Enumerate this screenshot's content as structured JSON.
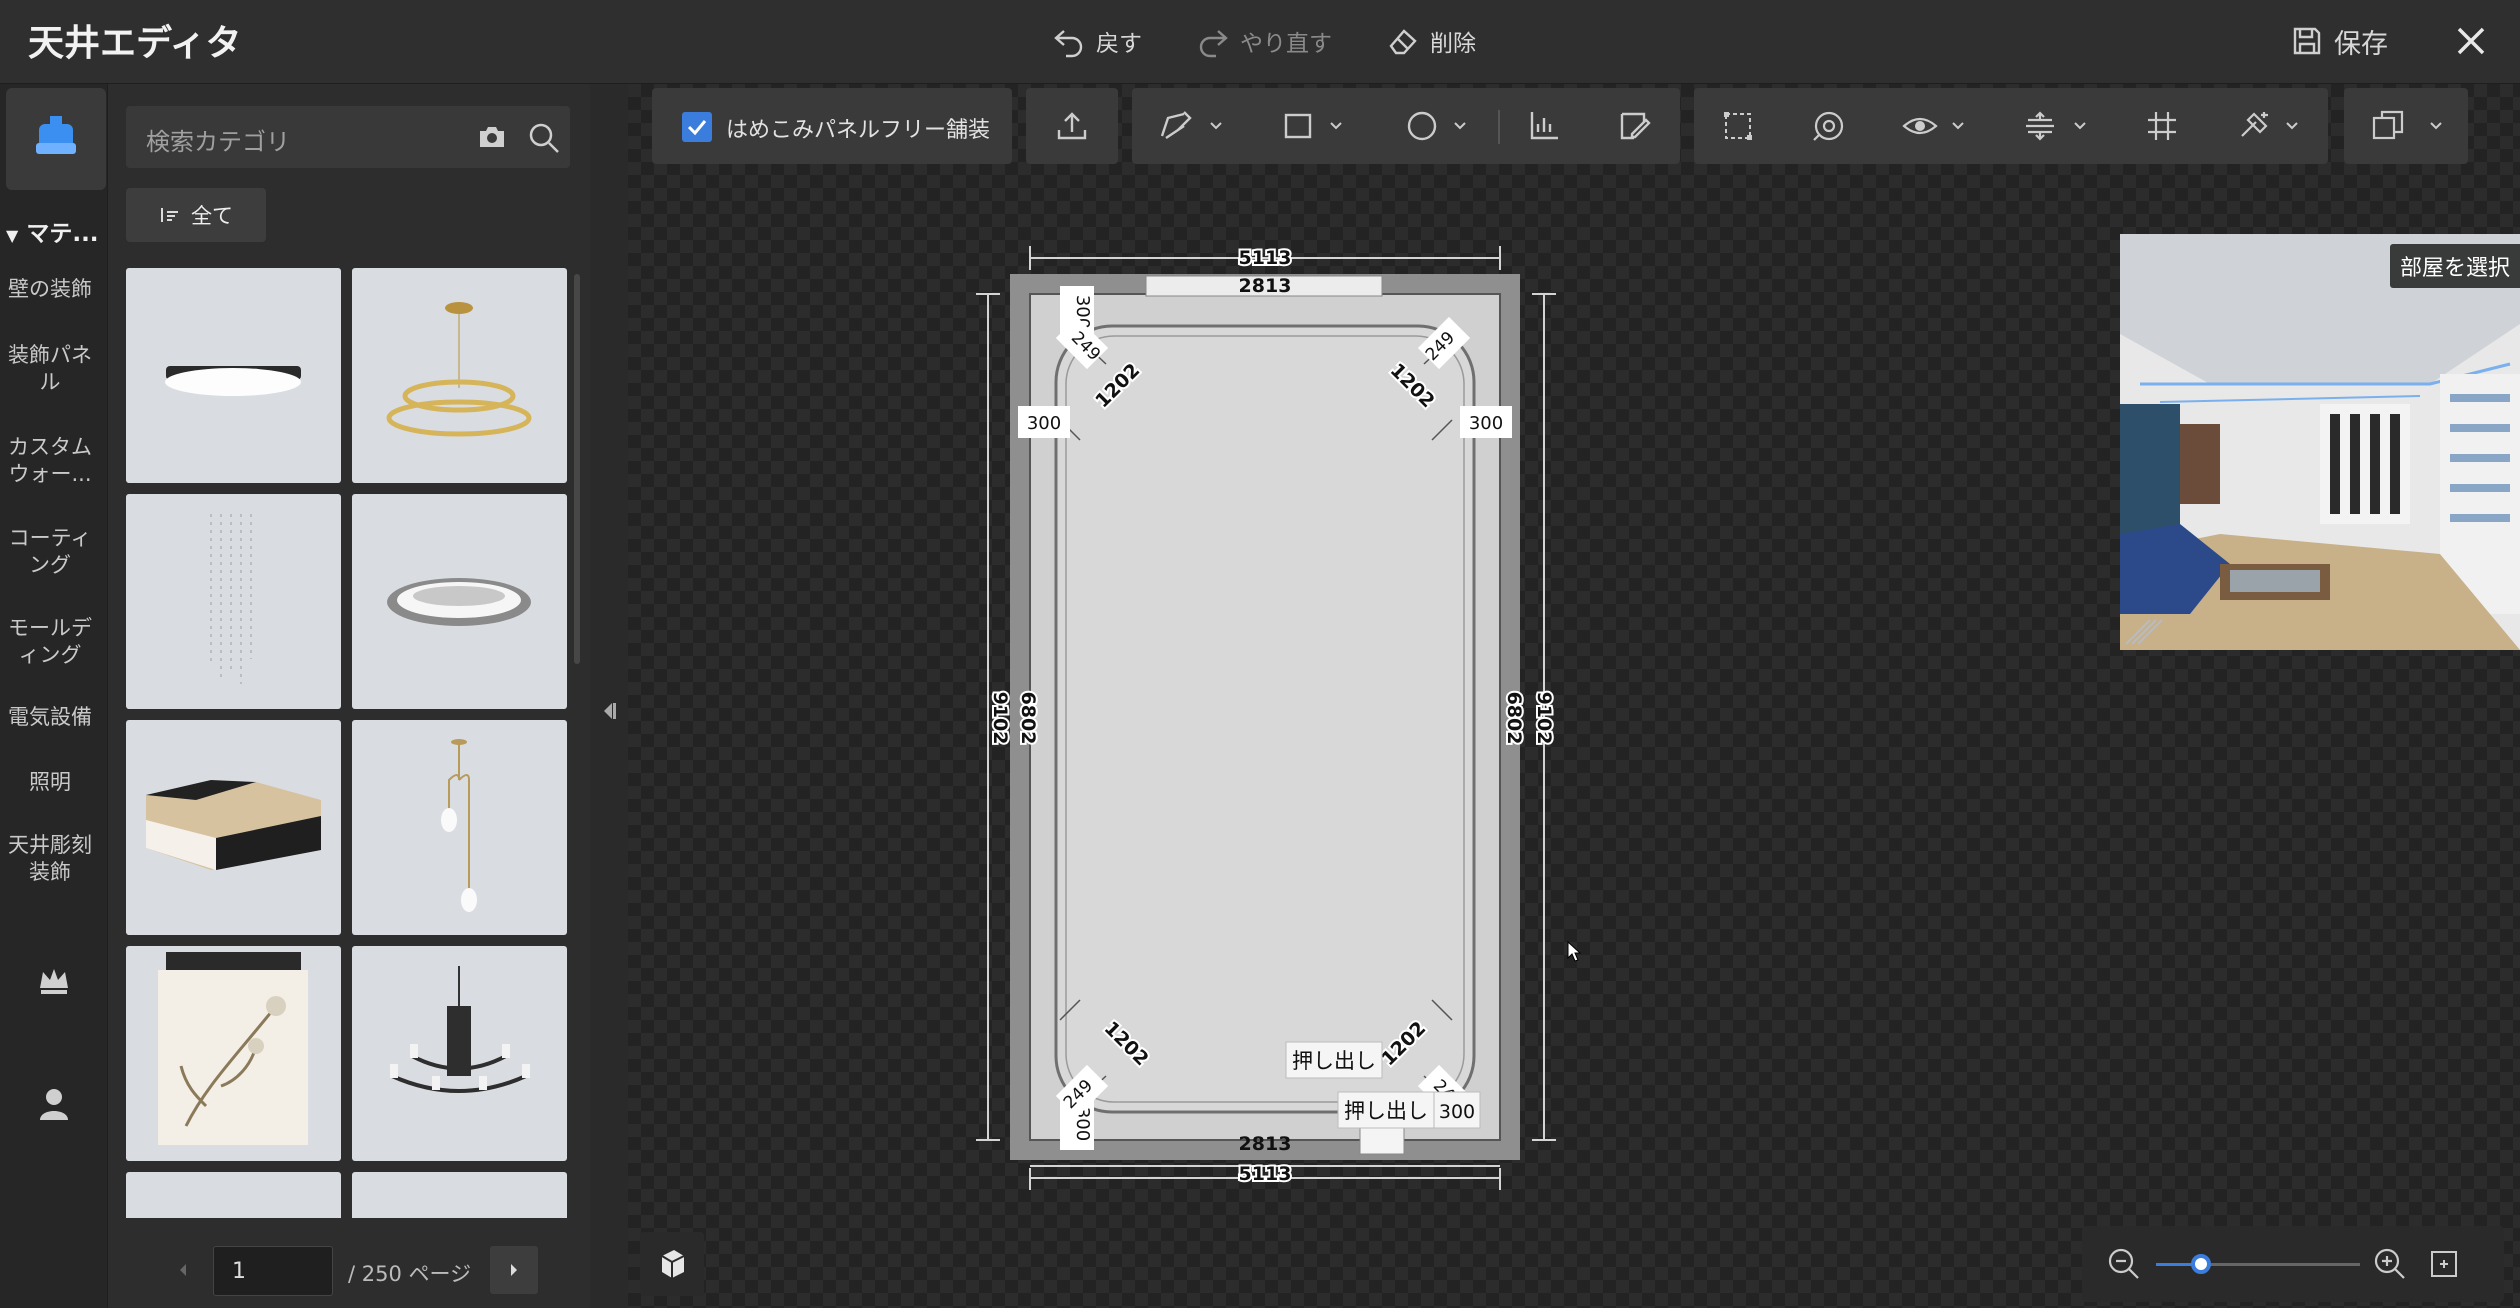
{
  "header": {
    "title": "天井エディタ",
    "undo_label": "戻す",
    "redo_label": "やり直す",
    "delete_label": "削除",
    "save_label": "保存",
    "close_icon": "close-icon"
  },
  "sidebar": {
    "group_label": "マテ...",
    "items": [
      {
        "label": "壁の装飾"
      },
      {
        "label": "装飾パネル"
      },
      {
        "label": "カスタムウォー..."
      },
      {
        "label": "コーティング"
      },
      {
        "label": "モールディング"
      },
      {
        "label": "電気設備"
      },
      {
        "label": "照明"
      },
      {
        "label": "天井彫刻装飾"
      }
    ],
    "extra_icons": [
      "crown-icon",
      "user-icon"
    ]
  },
  "library": {
    "search_placeholder": "検索カテゴリ",
    "filter_label": "全て",
    "items": [
      {
        "icon": "flush-ceiling-light"
      },
      {
        "icon": "ring-chandelier"
      },
      {
        "icon": "crystal-pendant"
      },
      {
        "icon": "round-ceiling-lamp"
      },
      {
        "icon": "square-ceiling-lamp"
      },
      {
        "icon": "pendant-lamp"
      },
      {
        "icon": "floral-lamp"
      },
      {
        "icon": "candle-chandelier"
      }
    ],
    "page_current": "1",
    "page_total": "/ 250 ページ"
  },
  "toolbar": {
    "seamless_label": "はめこみパネルフリー舗装",
    "seamless_checked": true
  },
  "plan": {
    "dims": {
      "outer_width": "5113",
      "inner_width": "2813",
      "outer_height": "9102",
      "inner_height": "6802",
      "side_offset": "300",
      "corner_radius": "249",
      "corner_diag": "1202"
    },
    "extrude_label": "押し出し"
  },
  "preview": {
    "label": "部屋を選択"
  },
  "zoom": {
    "level": 0.22
  },
  "colors": {
    "accent": "#3b7ddd",
    "background": "#2b2b2b",
    "panel": "#2d2d2d",
    "toolbar": "#3a3a3a"
  }
}
